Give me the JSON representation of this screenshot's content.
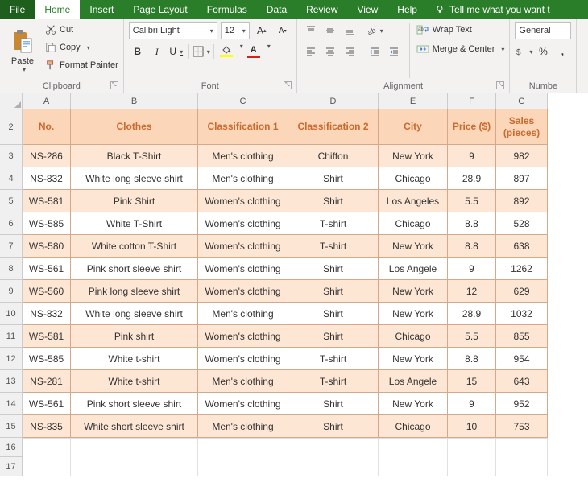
{
  "menu": {
    "file": "File",
    "home": "Home",
    "insert": "Insert",
    "pagelayout": "Page Layout",
    "formulas": "Formulas",
    "data": "Data",
    "review": "Review",
    "view": "View",
    "help": "Help",
    "tellme": "Tell me what you want t"
  },
  "ribbon": {
    "clipboard": {
      "paste": "Paste",
      "cut": "Cut",
      "copy": "Copy",
      "format_painter": "Format Painter",
      "label": "Clipboard"
    },
    "font": {
      "name": "Calibri Light",
      "size": "12",
      "label": "Font"
    },
    "alignment": {
      "wrap": "Wrap Text",
      "merge": "Merge & Center",
      "label": "Alignment"
    },
    "number": {
      "format": "General",
      "label": "Numbe"
    }
  },
  "sheet": {
    "columns": [
      "A",
      "B",
      "C",
      "D",
      "E",
      "F",
      "G"
    ],
    "row_start": 2,
    "headers": [
      "No.",
      "Clothes",
      "Classification 1",
      "Classification 2",
      "City",
      "Price ($)",
      "Sales (pieces)"
    ],
    "data": [
      [
        "NS-286",
        "Black T-Shirt",
        "Men's clothing",
        "Chiffon",
        "New York",
        "9",
        "982"
      ],
      [
        "NS-832",
        "White long sleeve shirt",
        "Men's clothing",
        "Shirt",
        "Chicago",
        "28.9",
        "897"
      ],
      [
        "WS-581",
        "Pink Shirt",
        "Women's clothing",
        "Shirt",
        "Los Angeles",
        "5.5",
        "892"
      ],
      [
        "WS-585",
        "White T-Shirt",
        "Women's clothing",
        "T-shirt",
        "Chicago",
        "8.8",
        "528"
      ],
      [
        "WS-580",
        "White cotton T-Shirt",
        "Women's clothing",
        "T-shirt",
        "New York",
        "8.8",
        "638"
      ],
      [
        "WS-561",
        "Pink short sleeve shirt",
        "Women's clothing",
        "Shirt",
        "Los Angele",
        "9",
        "1262"
      ],
      [
        "WS-560",
        "Pink long sleeve shirt",
        "Women's clothing",
        "Shirt",
        "New York",
        "12",
        "629"
      ],
      [
        "NS-832",
        "White long sleeve shirt",
        "Men's clothing",
        "Shirt",
        "New York",
        "28.9",
        "1032"
      ],
      [
        "WS-581",
        "Pink shirt",
        "Women's clothing",
        "Shirt",
        "Chicago",
        "5.5",
        "855"
      ],
      [
        "WS-585",
        "White t-shirt",
        "Women's clothing",
        "T-shirt",
        "New York",
        "8.8",
        "954"
      ],
      [
        "NS-281",
        "White t-shirt",
        "Men's clothing",
        "T-shirt",
        "Los Angele",
        "15",
        "643"
      ],
      [
        "WS-561",
        "Pink short sleeve shirt",
        "Women's clothing",
        "Shirt",
        "New York",
        "9",
        "952"
      ],
      [
        "NS-835",
        "White short sleeve shirt",
        "Men's clothing",
        "Shirt",
        "Chicago",
        "10",
        "753"
      ]
    ],
    "empty_rows": [
      16,
      17
    ]
  }
}
